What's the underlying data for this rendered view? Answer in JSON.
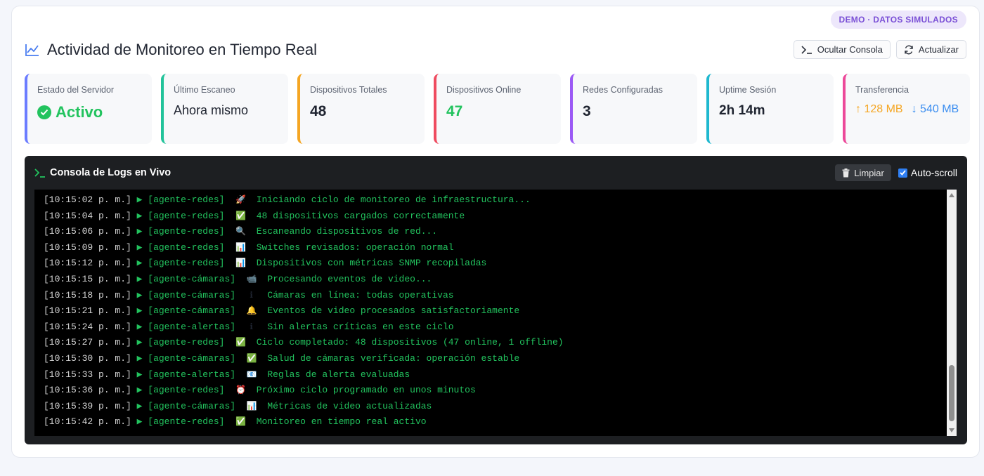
{
  "badge": "DEMO · DATOS SIMULADOS",
  "header": {
    "title": "Actividad de Monitoreo en Tiempo Real"
  },
  "actions": {
    "hide_console": "Ocultar Consola",
    "refresh": "Actualizar"
  },
  "stats": [
    {
      "label": "Estado del Servidor",
      "value": "Activo",
      "accent": "#6b7cff"
    },
    {
      "label": "Último Escaneo",
      "value": "Ahora mismo",
      "accent": "#22c39a"
    },
    {
      "label": "Dispositivos Totales",
      "value": "48",
      "accent": "#f5a623"
    },
    {
      "label": "Dispositivos Online",
      "value": "47",
      "accent": "#ef4b5f"
    },
    {
      "label": "Redes Configuradas",
      "value": "3",
      "accent": "#9b59f5"
    },
    {
      "label": "Uptime Sesión",
      "value": "2h 14m",
      "accent": "#1fb8cf"
    },
    {
      "label": "Transferencia",
      "up": "128 MB",
      "down": "540 MB",
      "accent": "#ec4899"
    }
  ],
  "console": {
    "title": "Consola de Logs en Vivo",
    "clear_label": "Limpiar",
    "autoscroll_label": "Auto-scroll",
    "autoscroll_checked": true,
    "logs": [
      {
        "ts": "[10:15:02 p. m.]",
        "agent": "[agente-redes]",
        "icon": "rocket-icon",
        "msg": "Iniciando ciclo de monitoreo de infraestructura..."
      },
      {
        "ts": "[10:15:04 p. m.]",
        "agent": "[agente-redes]",
        "icon": "check-icon",
        "msg": "48 dispositivos cargados correctamente"
      },
      {
        "ts": "[10:15:06 p. m.]",
        "agent": "[agente-redes]",
        "icon": "magnifier-icon",
        "msg": "Escaneando dispositivos de red..."
      },
      {
        "ts": "[10:15:09 p. m.]",
        "agent": "[agente-redes]",
        "icon": "chart-icon",
        "msg": "Switches revisados: operación normal"
      },
      {
        "ts": "[10:15:12 p. m.]",
        "agent": "[agente-redes]",
        "icon": "chart-icon",
        "msg": "Dispositivos con métricas SNMP recopiladas"
      },
      {
        "ts": "[10:15:15 p. m.]",
        "agent": "[agente-cámaras]",
        "icon": "camera-icon",
        "msg": "Procesando eventos de video..."
      },
      {
        "ts": "[10:15:18 p. m.]",
        "agent": "[agente-cámaras]",
        "icon": "info-icon",
        "msg": "Cámaras en línea: todas operativas"
      },
      {
        "ts": "[10:15:21 p. m.]",
        "agent": "[agente-cámaras]",
        "icon": "bell-icon",
        "msg": "Eventos de video procesados satisfactoriamente"
      },
      {
        "ts": "[10:15:24 p. m.]",
        "agent": "[agente-alertas]",
        "icon": "info-icon",
        "msg": "Sin alertas críticas en este ciclo"
      },
      {
        "ts": "[10:15:27 p. m.]",
        "agent": "[agente-redes]",
        "icon": "check-icon",
        "msg": "Ciclo completado: 48 dispositivos (47 online, 1 offline)"
      },
      {
        "ts": "[10:15:30 p. m.]",
        "agent": "[agente-cámaras]",
        "icon": "check-icon",
        "msg": "Salud de cámaras verificada: operación estable"
      },
      {
        "ts": "[10:15:33 p. m.]",
        "agent": "[agente-alertas]",
        "icon": "mail-icon",
        "msg": "Reglas de alerta evaluadas"
      },
      {
        "ts": "[10:15:36 p. m.]",
        "agent": "[agente-redes]",
        "icon": "alarm-clock-icon",
        "msg": "Próximo ciclo programado en unos minutos"
      },
      {
        "ts": "[10:15:39 p. m.]",
        "agent": "[agente-cámaras]",
        "icon": "chart-icon",
        "msg": "Métricas de video actualizadas"
      },
      {
        "ts": "[10:15:42 p. m.]",
        "agent": "[agente-redes]",
        "icon": "check-icon",
        "msg": "Monitoreo en tiempo real activo"
      }
    ]
  }
}
